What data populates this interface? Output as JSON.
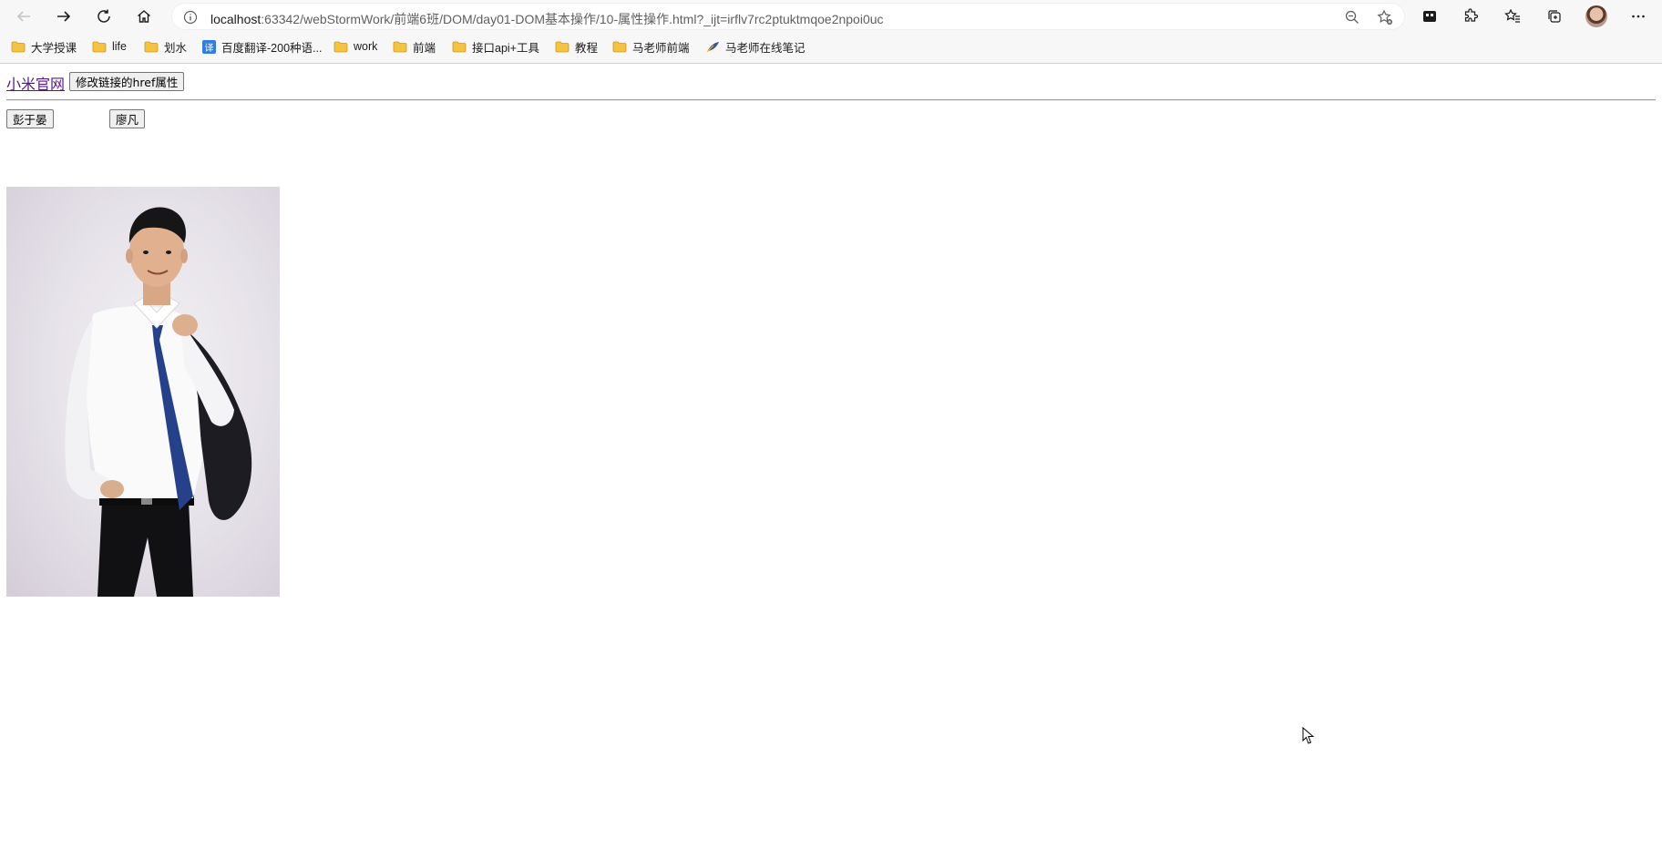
{
  "browser": {
    "url_host": "localhost",
    "url_rest": ":63342/webStormWork/前端6班/DOM/day01-DOM基本操作/10-属性操作.html?_ijt=irflv7rc2ptuktmqoe2npoi0uc",
    "bookmarks": [
      {
        "label": "大学授课",
        "icon": "folder-icon"
      },
      {
        "label": "life",
        "icon": "folder-icon"
      },
      {
        "label": "划水",
        "icon": "folder-icon"
      },
      {
        "label": "百度翻译-200种语...",
        "icon": "translate-icon"
      },
      {
        "label": "work",
        "icon": "folder-icon"
      },
      {
        "label": "前端",
        "icon": "folder-icon"
      },
      {
        "label": "接口api+工具",
        "icon": "folder-icon"
      },
      {
        "label": "教程",
        "icon": "folder-icon"
      },
      {
        "label": "马老师前端",
        "icon": "folder-icon"
      },
      {
        "label": "马老师在线笔记",
        "icon": "feather-icon"
      }
    ]
  },
  "page": {
    "link_text": "小米官网",
    "change_href_button": "修改链接的href属性",
    "person_button_1": "彭于晏",
    "person_button_2": "廖凡"
  },
  "colors": {
    "link_visited": "#551a8b",
    "folder_yellow": "#f5c343"
  }
}
